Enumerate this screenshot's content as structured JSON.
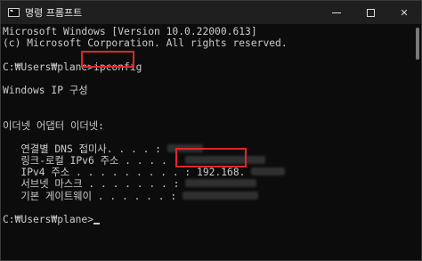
{
  "window": {
    "title": "명령 프롬프트",
    "icon": "terminal-icon",
    "controls": {
      "minimize": "minimize-icon",
      "maximize": "maximize-icon",
      "close": "✕"
    }
  },
  "console": {
    "lines": [
      "Microsoft Windows [Version 10.0.22000.613]",
      "(c) Microsoft Corporation. All rights reserved.",
      "",
      "C:₩Users₩plane>ipconfig",
      "",
      "Windows IP 구성",
      "",
      "",
      "이더넷 어댑터 이더넷:",
      "",
      "   연결별 DNS 접미사. . . . :",
      "   링크-로컬 IPv6 주소 . . . . :",
      "   IPv4 주소 . . . . . . . . . : 192.168.",
      "   서브넷 마스크 . . . . . . . :",
      "   기본 게이트웨이 . . . . . . :",
      "",
      "C:₩Users₩plane>"
    ]
  },
  "colors": {
    "background": "#0c0c0c",
    "text": "#cccccc",
    "highlight_box": "#e0262b",
    "titlebar": "#1f1f1f"
  }
}
